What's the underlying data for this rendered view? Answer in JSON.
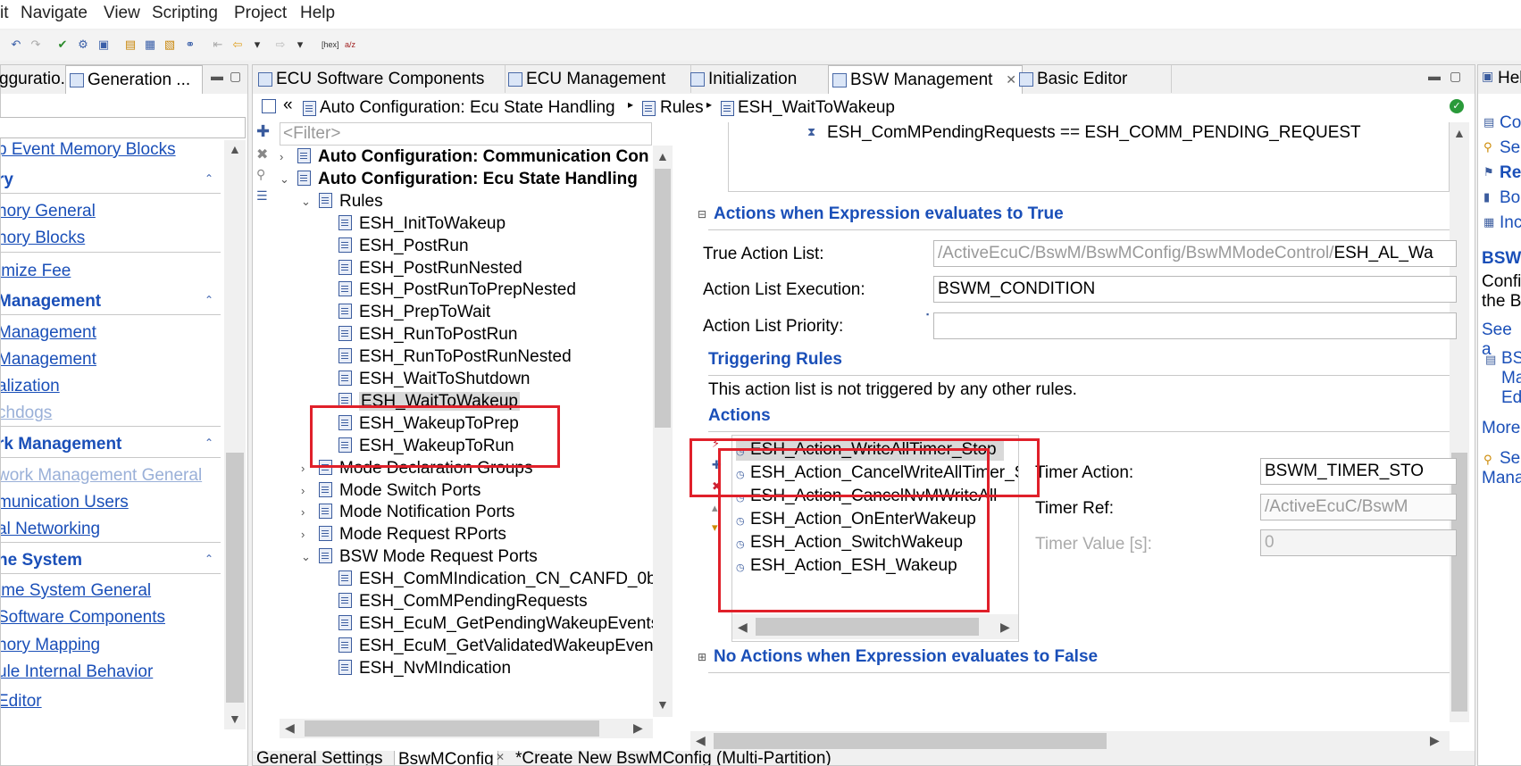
{
  "menu": [
    "it",
    "Navigate",
    "View",
    "Scripting",
    "Project",
    "Help"
  ],
  "left_tabs": [
    "gguratio...",
    "Generation ..."
  ],
  "left_sections": [
    {
      "type": "link",
      "label": "p Event Memory Blocks"
    },
    {
      "type": "header",
      "label": "ry"
    },
    {
      "type": "link",
      "label": "nory General"
    },
    {
      "type": "link",
      "label": "nory Blocks"
    },
    {
      "type": "link",
      "label": "imize Fee"
    },
    {
      "type": "header",
      "label": " Management"
    },
    {
      "type": "link",
      "label": " Management"
    },
    {
      "type": "link",
      "label": " Management"
    },
    {
      "type": "link",
      "label": "alization"
    },
    {
      "type": "linkdis",
      "label": "chdogs"
    },
    {
      "type": "header",
      "label": "rk Management"
    },
    {
      "type": "linkdis",
      "label": "work Management General"
    },
    {
      "type": "link",
      "label": "munication Users"
    },
    {
      "type": "link",
      "label": "al Networking"
    },
    {
      "type": "header",
      "label": "ne System"
    },
    {
      "type": "link",
      "label": "ime System General"
    },
    {
      "type": "link",
      "label": "Software Components"
    },
    {
      "type": "link",
      "label": "nory Mapping"
    },
    {
      "type": "link",
      "label": "ule Internal Behavior"
    },
    {
      "type": "link",
      "label": " Editor"
    }
  ],
  "editor_tabs": [
    "ECU Software Components",
    "ECU Management",
    "Initialization",
    "BSW Management",
    "Basic Editor"
  ],
  "breadcrumb": [
    "Auto Configuration: Ecu State Handling",
    "Rules",
    "ESH_WaitToWakeup"
  ],
  "tree": {
    "filter_placeholder": "<Filter>",
    "items": [
      {
        "label": "Auto Configuration: Communication Con",
        "bold": true,
        "level": 0,
        "twisty": ">"
      },
      {
        "label": "Auto Configuration: Ecu State Handling",
        "bold": true,
        "level": 0,
        "twisty": "v"
      },
      {
        "label": "Rules",
        "level": 1,
        "twisty": "v"
      },
      {
        "label": "ESH_InitToWakeup",
        "level": 2
      },
      {
        "label": "ESH_PostRun",
        "level": 2
      },
      {
        "label": "ESH_PostRunNested",
        "level": 2
      },
      {
        "label": "ESH_PostRunToPrepNested",
        "level": 2
      },
      {
        "label": "ESH_PrepToWait",
        "level": 2
      },
      {
        "label": "ESH_RunToPostRun",
        "level": 2
      },
      {
        "label": "ESH_RunToPostRunNested",
        "level": 2
      },
      {
        "label": "ESH_WaitToShutdown",
        "level": 2
      },
      {
        "label": "ESH_WaitToWakeup",
        "level": 2,
        "selected": true
      },
      {
        "label": "ESH_WakeupToPrep",
        "level": 2
      },
      {
        "label": "ESH_WakeupToRun",
        "level": 2
      },
      {
        "label": "Mode Declaration Groups",
        "level": 1,
        "twisty": ">"
      },
      {
        "label": "Mode Switch Ports",
        "level": 1,
        "twisty": ">"
      },
      {
        "label": "Mode Notification Ports",
        "level": 1,
        "twisty": ">"
      },
      {
        "label": "Mode Request RPorts",
        "level": 1,
        "twisty": ">"
      },
      {
        "label": "BSW Mode Request Ports",
        "level": 1,
        "twisty": "v"
      },
      {
        "label": "ESH_ComMIndication_CN_CANFD_0b",
        "level": 2
      },
      {
        "label": "ESH_ComMPendingRequests",
        "level": 2
      },
      {
        "label": "ESH_EcuM_GetPendingWakeupEvents",
        "level": 2
      },
      {
        "label": "ESH_EcuM_GetValidatedWakeupEven",
        "level": 2
      },
      {
        "label": "ESH_NvMIndication",
        "level": 2
      }
    ]
  },
  "detail": {
    "expression_line": "ESH_ComMPendingRequests == ESH_COMM_PENDING_REQUEST",
    "section_true": "Actions when Expression evaluates to True",
    "true_action_list_label": "True Action List:",
    "true_action_list_value_path": "/ActiveEcuC/BswM/BswMConfig/BswMModeControl/",
    "true_action_list_value_name": "ESH_AL_Wa",
    "exec_label": "Action List Execution:",
    "exec_value": "BSWM_CONDITION",
    "priority_label": "Action List Priority:",
    "priority_value": "",
    "triggering_title": "Triggering Rules",
    "triggering_text": "This action list is not triggered by any other rules.",
    "actions_title": "Actions",
    "actions": [
      "ESH_Action_WriteAllTimer_Stop",
      "ESH_Action_CancelWriteAllTimer_Sta",
      "ESH_Action_CancelNvMWriteAll",
      "ESH_Action_OnEnterWakeup",
      "ESH_Action_SwitchWakeup",
      "ESH_Action_ESH_Wakeup"
    ],
    "timer_action_label": "Timer Action:",
    "timer_action_value": "BSWM_TIMER_STO",
    "timer_ref_label": "Timer Ref:",
    "timer_ref_value": "/ActiveEcuC/BswM",
    "timer_value_label": "Timer Value [s]:",
    "timer_value_value": "0",
    "section_false": "No Actions when Expression evaluates to False"
  },
  "bottom_tabs": [
    "General Settings",
    "BswMConfig",
    "*Create New BswMConfig (Multi-Partition)"
  ],
  "help": {
    "tab": "Hel",
    "links": [
      "Co",
      "Sea",
      "Re",
      "Boo",
      "Inc"
    ],
    "heading": "BSW",
    "text1": "Confi",
    "text2": "the B",
    "see": "See a",
    "link_b1": "BS",
    "link_b2": "Ma",
    "link_b3": "Ed",
    "more": "More",
    "sea2": "Sea",
    "mana": "Mana"
  }
}
